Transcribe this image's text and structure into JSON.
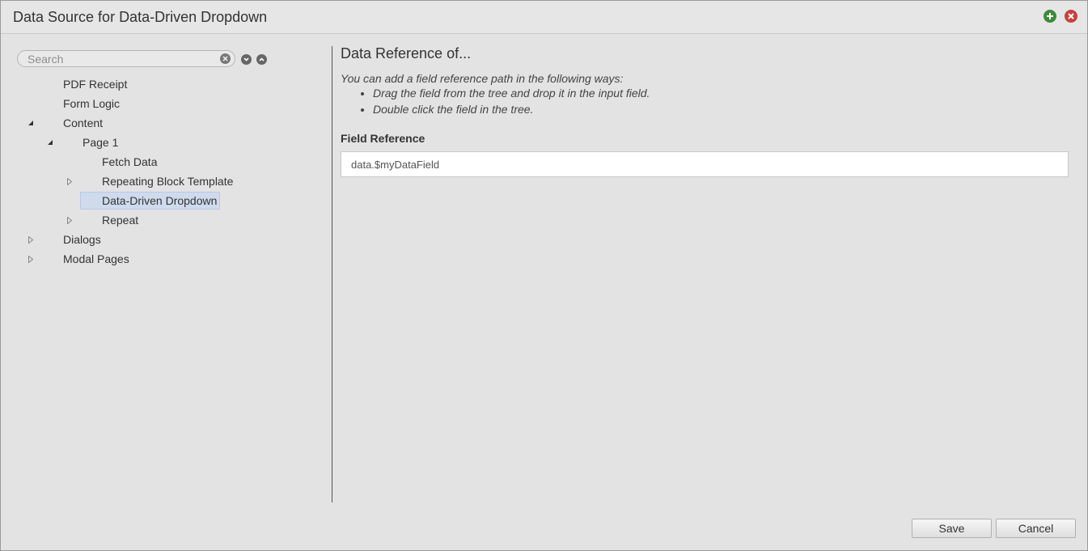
{
  "window": {
    "title": "Data Source for Data-Driven Dropdown"
  },
  "titlebar": {
    "add_icon": "plus-circle-icon",
    "close_icon": "x-circle-icon",
    "add_color": "#3c8a3c",
    "close_color": "#c9403c"
  },
  "search": {
    "placeholder": "Search",
    "value": "",
    "clear_icon": "x-circle-icon",
    "next_icon": "chevron-down-circle-icon",
    "prev_icon": "chevron-up-circle-icon"
  },
  "tree": {
    "items": [
      {
        "label": "PDF Receipt",
        "toggle": "none"
      },
      {
        "label": "Form Logic",
        "toggle": "none"
      },
      {
        "label": "Content",
        "toggle": "expanded"
      },
      {
        "label": "Page 1",
        "toggle": "expanded"
      },
      {
        "label": "Fetch Data",
        "toggle": "none"
      },
      {
        "label": "Repeating Block Template",
        "toggle": "collapsed"
      },
      {
        "label": "Data-Driven Dropdown",
        "toggle": "none",
        "selected": true
      },
      {
        "label": "Repeat",
        "toggle": "collapsed"
      },
      {
        "label": "Dialogs",
        "toggle": "collapsed"
      },
      {
        "label": "Modal Pages",
        "toggle": "collapsed"
      }
    ]
  },
  "detail": {
    "heading": "Data Reference of...",
    "intro": "You can add a field reference path in the following ways:",
    "ways": [
      "Drag the field from the tree and drop it in the input field.",
      "Double click the field in the tree."
    ],
    "field_label": "Field Reference",
    "field_value": "data.$myDataField"
  },
  "footer": {
    "save_label": "Save",
    "cancel_label": "Cancel"
  },
  "colors": {
    "background": "#e3e3e3",
    "selection": "#cfdbed"
  }
}
